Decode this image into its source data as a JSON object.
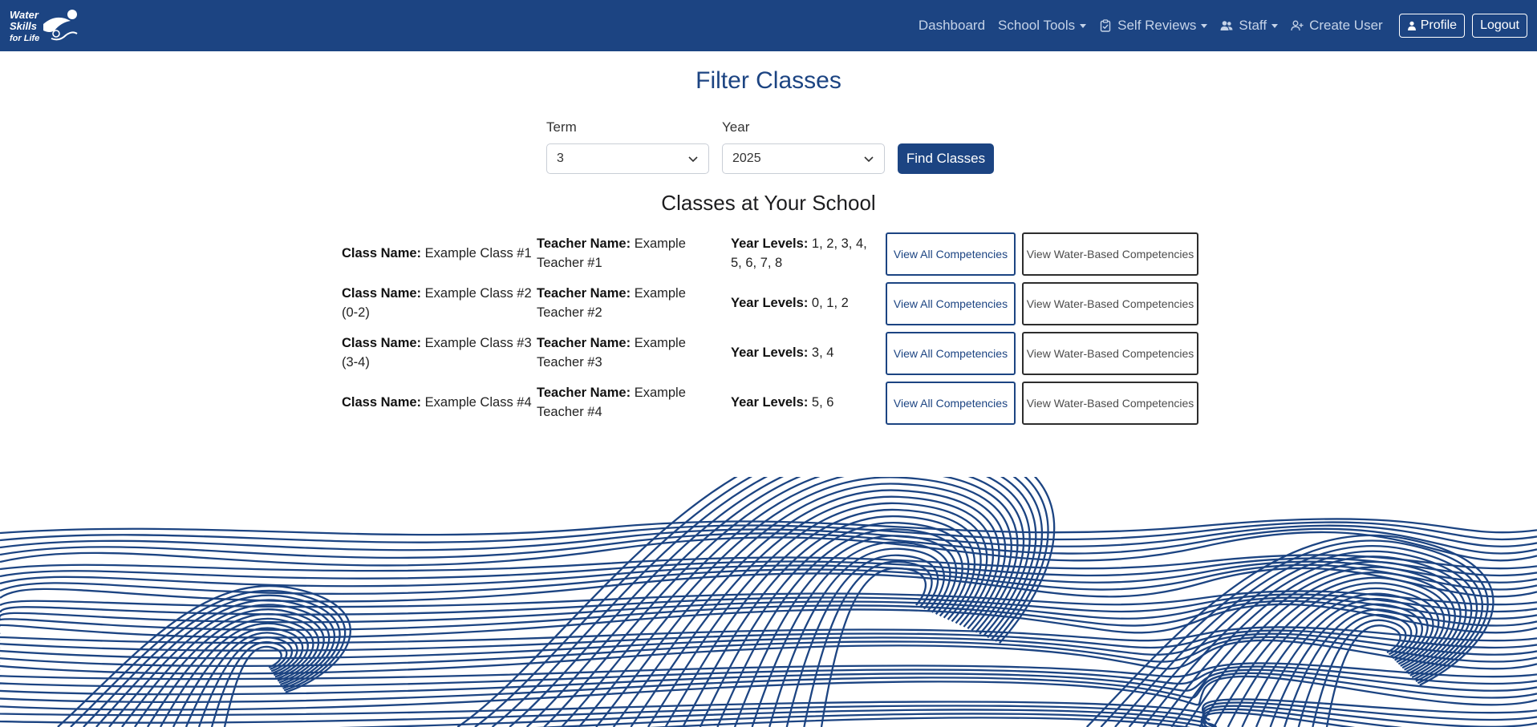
{
  "brand": {
    "logo_lines": [
      "Water",
      "Skills",
      "for Life"
    ],
    "colors": {
      "primary": "#1c4482",
      "nav_text": "#c5d3e8"
    }
  },
  "nav": {
    "dashboard": "Dashboard",
    "school_tools": "School Tools",
    "self_reviews": "Self Reviews",
    "staff": "Staff",
    "create_user": "Create User",
    "profile": "Profile",
    "logout": "Logout",
    "icons": [
      "clipboard-check-icon",
      "people-icon",
      "person-plus-icon",
      "person-icon"
    ]
  },
  "filter": {
    "title": "Filter Classes",
    "term_label": "Term",
    "term_value": "3",
    "year_label": "Year",
    "year_value": "2025",
    "find_label": "Find Classes"
  },
  "classes": {
    "title": "Classes at Your School",
    "class_name_label": "Class Name:",
    "teacher_name_label": "Teacher Name:",
    "year_levels_label": "Year Levels:",
    "view_all_label": "View All Competencies",
    "view_water_label": "View Water-Based Competencies",
    "rows": [
      {
        "class_name": "Example Class #1",
        "teacher_name": "Example Teacher #1",
        "year_levels": "1, 2, 3, 4, 5, 6, 7, 8"
      },
      {
        "class_name": "Example Class #2 (0-2)",
        "teacher_name": "Example Teacher #2",
        "year_levels": "0, 1, 2"
      },
      {
        "class_name": "Example Class #3 (3-4)",
        "teacher_name": "Example Teacher #3",
        "year_levels": "3, 4"
      },
      {
        "class_name": "Example Class #4",
        "teacher_name": "Example Teacher #4",
        "year_levels": "5, 6"
      }
    ]
  }
}
